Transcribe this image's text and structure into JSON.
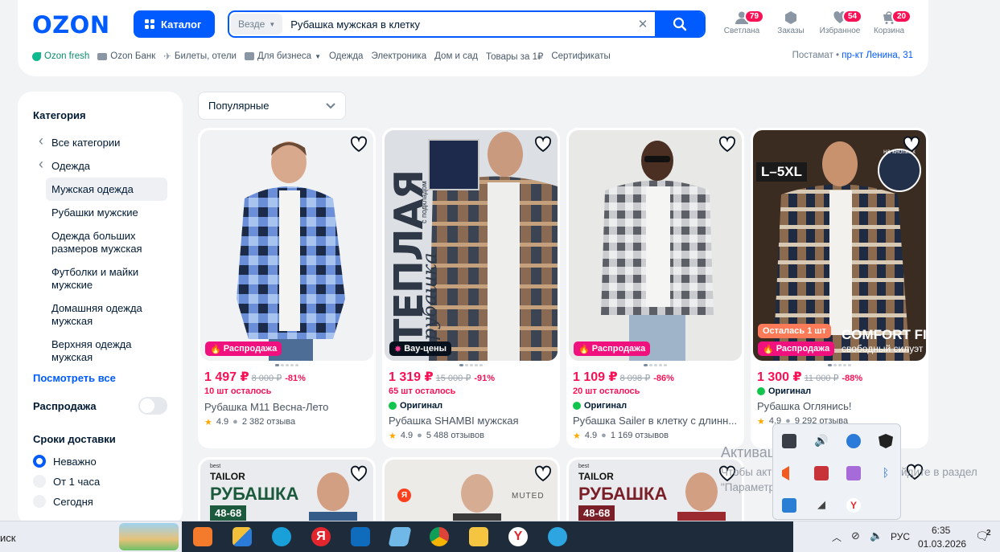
{
  "header": {
    "logo": "OZON",
    "catalog_label": "Каталог",
    "search": {
      "scope": "Везде",
      "query": "Рубашка мужская в клетку"
    },
    "icons": [
      {
        "name": "profile",
        "label": "Светлана",
        "badge": "79"
      },
      {
        "name": "orders",
        "label": "Заказы",
        "badge": ""
      },
      {
        "name": "favorites",
        "label": "Избранное",
        "badge": "54"
      },
      {
        "name": "cart",
        "label": "Корзина",
        "badge": "20"
      }
    ],
    "subnav": [
      "Ozon fresh",
      "Ozon Банк",
      "Билеты, отели",
      "Для бизнеса",
      "Одежда",
      "Электроника",
      "Дом и сад",
      "Товары за 1₽",
      "Сертификаты"
    ],
    "delivery_label": "Постамат •",
    "address": "пр-кт Ленина, 31"
  },
  "sidebar": {
    "category_title": "Категория",
    "items": [
      "Все категории",
      "Одежда",
      "Мужская одежда",
      "Рубашки мужские",
      "Одежда больших размеров мужская",
      "Футболки и майки мужские",
      "Домашняя одежда мужская",
      "Верхняя одежда мужская"
    ],
    "see_all": "Посмотреть все",
    "sale_label": "Распродажа",
    "sale_enabled": false,
    "delivery_title": "Сроки доставки",
    "delivery_options": [
      "Неважно",
      "От 1 часа",
      "Сегодня"
    ],
    "delivery_selected": "Неважно"
  },
  "sort": {
    "selected": "Популярные"
  },
  "products": [
    {
      "tag": "Распродажа",
      "price": "1 497 ₽",
      "old_price": "8 000 ₽",
      "discount": "-81%",
      "stock": "10 шт осталось",
      "original": "",
      "title": "Рубашка M11 Весна-Лето",
      "rating": "4.9",
      "reviews": "2 382 отзыва"
    },
    {
      "tag": "Вау-цены",
      "price": "1 319 ₽",
      "old_price": "15 000 ₽",
      "discount": "-91%",
      "stock": "65 шт осталось",
      "original": "Оригинал",
      "title": "Рубашка SHAMBI мужская",
      "rating": "4.9",
      "reviews": "5 488 отзывов",
      "image_text": {
        "big": "ТЕПЛАЯ",
        "script": "рубашка",
        "small": "с подкладом"
      }
    },
    {
      "tag": "Распродажа",
      "price": "1 109 ₽",
      "old_price": "8 098 ₽",
      "discount": "-86%",
      "stock": "20 шт осталось",
      "original": "Оригинал",
      "title": "Рубашка Sailer в клетку с длинн...",
      "rating": "4.9",
      "reviews": "1 169 отзывов"
    },
    {
      "tag": "Распродажа",
      "tag2": "Осталась 1 шт",
      "price": "1 300 ₽",
      "old_price": "11 000 ₽",
      "discount": "-88%",
      "stock": "",
      "original": "Оригинал",
      "title": "Рубашка Оглянись!",
      "rating": "4.9",
      "reviews": "9 292 отзыва",
      "image_text": {
        "size": "L–5XL",
        "fit": "COMFORT FIT",
        "silhouette": "свободный силуэт",
        "buttons": "на кнопках"
      }
    }
  ],
  "row2": [
    {
      "brand_small": "best",
      "brand": "TAILOR",
      "title": "РУБАШКА",
      "size": "48-68"
    },
    {
      "brand": "MUTED",
      "badge": "Я"
    },
    {
      "brand_small": "best",
      "brand": "TAILOR",
      "title": "РУБАШКА",
      "size": "48-68"
    }
  ],
  "activation": {
    "title": "Активация Windows",
    "text": "Чтобы активировать Windows, перейдите в раздел \"Параметры\"."
  },
  "taskbar": {
    "left_text": "иск",
    "lang": "РУС",
    "time": "6:35",
    "date": "01.03.2026",
    "notifications": "2"
  },
  "colors": {
    "brand": "#005bff",
    "sale": "#f91155",
    "tag_pink": "#f1117e"
  }
}
